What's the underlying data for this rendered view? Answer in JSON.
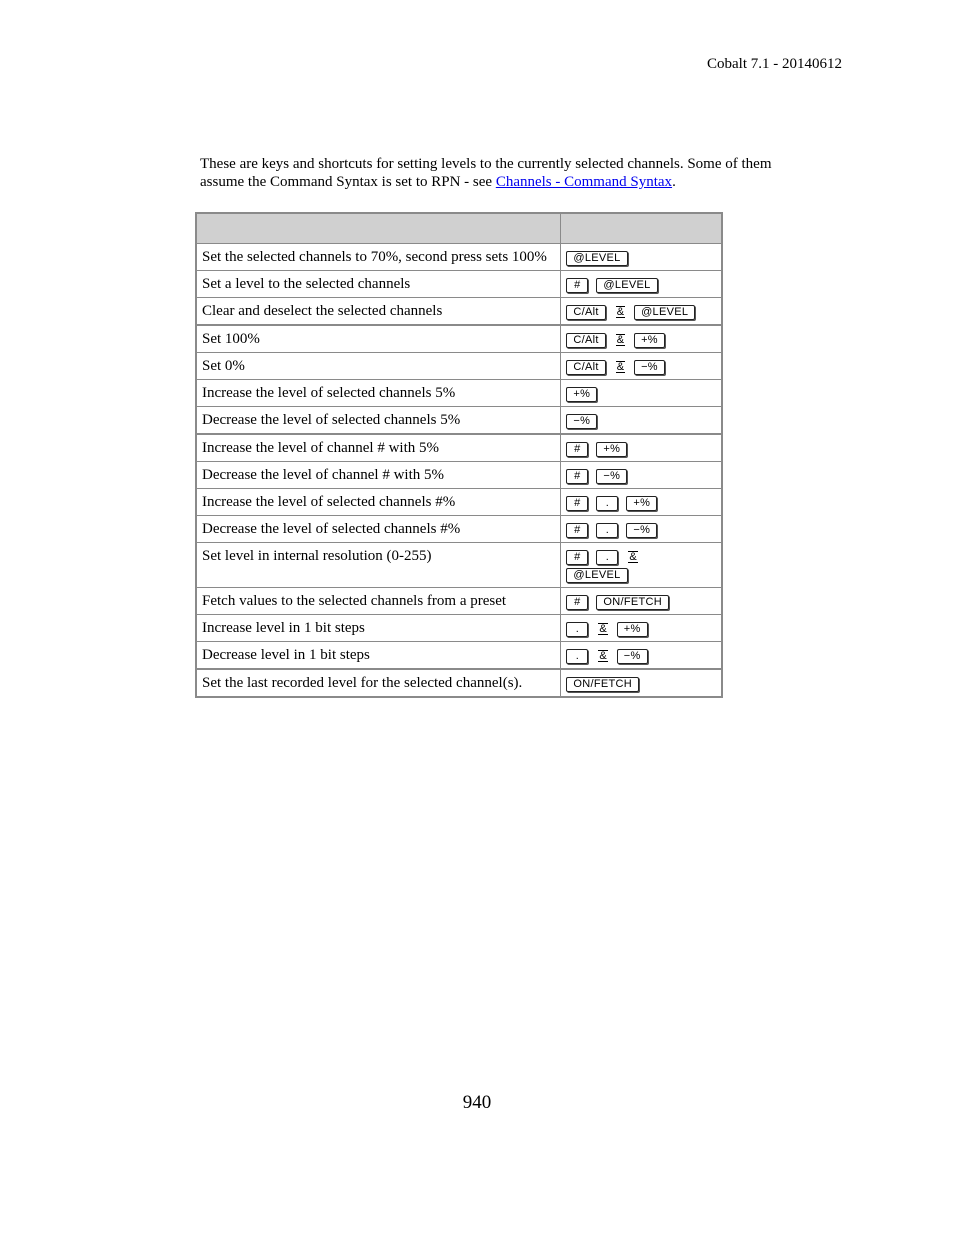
{
  "header": {
    "title": "Cobalt 7.1 - 20140612"
  },
  "intro": {
    "text": "These are keys and shortcuts for setting levels to the currently selected channels. Some of them assume the Command Syntax is set to RPN - see ",
    "link_label": "Channels - Command Syntax",
    "trailing": "."
  },
  "table": {
    "headers": [
      "",
      ""
    ],
    "rows": [
      {
        "description": "Set the selected channels to 70%, second press sets 100%",
        "keys": [
          "@LEVEL"
        ]
      },
      {
        "description": "Set a level to the selected channels",
        "keys": [
          "#",
          "@LEVEL"
        ]
      },
      {
        "description": "Clear and deselect the selected channels",
        "keys": [
          "C/Alt",
          "&",
          "@LEVEL"
        ]
      },
      {
        "description": "Set 100%",
        "keys": [
          "C/Alt",
          "&",
          "+%"
        ]
      },
      {
        "description": "Set 0%",
        "keys": [
          "C/Alt",
          "&",
          "−%"
        ]
      },
      {
        "description": "Increase the level of selected channels 5%",
        "keys": [
          "+%"
        ]
      },
      {
        "description": "Decrease the level of selected channels 5%",
        "keys": [
          "−%"
        ]
      },
      {
        "description": "Increase the level of channel # with 5%",
        "keys": [
          "#",
          "+%"
        ]
      },
      {
        "description": "Decrease the level of channel # with 5%",
        "keys": [
          "#",
          "−%"
        ]
      },
      {
        "description": "Increase the level of selected channels #%",
        "keys": [
          "#",
          ".",
          "+%"
        ]
      },
      {
        "description": "Decrease the level of selected channels #%",
        "keys": [
          "#",
          ".",
          "−%"
        ]
      },
      {
        "description": "Set level in internal resolution (0-255)",
        "keys": [
          "#",
          ".",
          "&",
          "@LEVEL"
        ]
      },
      {
        "description": "Fetch values to the selected channels from a preset",
        "keys": [
          "#",
          "ON/FETCH"
        ]
      },
      {
        "description": "Increase level in 1 bit steps",
        "keys": [
          ".",
          "&",
          "+%"
        ]
      },
      {
        "description": "Decrease level in 1 bit steps",
        "keys": [
          ".",
          "&",
          "−%"
        ]
      },
      {
        "description": "Set the last recorded level for the selected channel(s).",
        "keys": [
          "ON/FETCH"
        ]
      }
    ]
  },
  "footer": {
    "page_number": "940"
  }
}
